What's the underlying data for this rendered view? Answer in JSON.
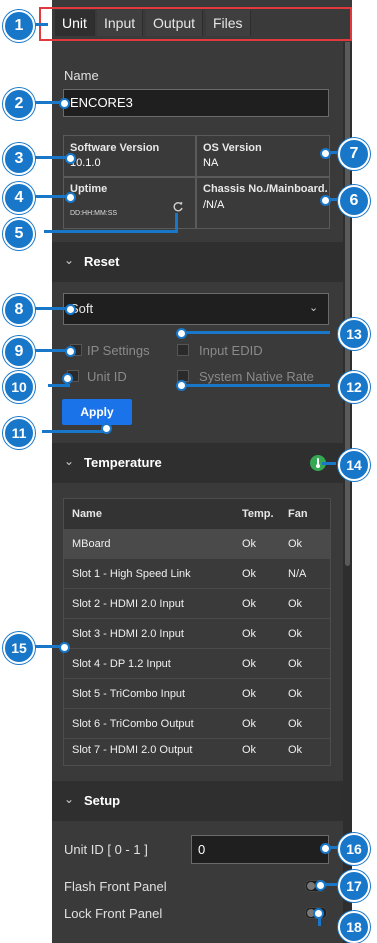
{
  "tabs": [
    {
      "label": "Unit"
    },
    {
      "label": "Input"
    },
    {
      "label": "Output"
    },
    {
      "label": "Files"
    }
  ],
  "name_field": {
    "label": "Name",
    "value": "ENCORE3"
  },
  "info": {
    "software_version": {
      "title": "Software Version",
      "value": "10.1.0"
    },
    "os_version": {
      "title": "OS Version",
      "value": "NA"
    },
    "uptime": {
      "title": "Uptime",
      "value": "DD:HH:MM:SS"
    },
    "chassis": {
      "title": "Chassis No./Mainboard...",
      "value": "/N/A"
    }
  },
  "reset": {
    "title": "Reset",
    "dropdown_value": "Soft",
    "options": [
      {
        "label": "IP Settings"
      },
      {
        "label": "Input EDID"
      },
      {
        "label": "Unit ID"
      },
      {
        "label": "System Native Rate"
      }
    ],
    "apply_label": "Apply"
  },
  "temperature": {
    "title": "Temperature",
    "status_color": "#34a853",
    "headers": {
      "name": "Name",
      "temp": "Temp.",
      "fan": "Fan"
    },
    "rows": [
      {
        "name": "MBoard",
        "temp": "Ok",
        "fan": "Ok"
      },
      {
        "name": "Slot 1 - High Speed Link",
        "temp": "Ok",
        "fan": "N/A"
      },
      {
        "name": "Slot 2 - HDMI 2.0 Input",
        "temp": "Ok",
        "fan": "Ok"
      },
      {
        "name": "Slot 3 - HDMI 2.0 Input",
        "temp": "Ok",
        "fan": "Ok"
      },
      {
        "name": "Slot 4 - DP 1.2 Input",
        "temp": "Ok",
        "fan": "Ok"
      },
      {
        "name": "Slot 5 - TriCombo Input",
        "temp": "Ok",
        "fan": "Ok"
      },
      {
        "name": "Slot 6 - TriCombo Output",
        "temp": "Ok",
        "fan": "Ok"
      },
      {
        "name": "Slot 7 - HDMI 2.0 Output",
        "temp": "Ok",
        "fan": "Ok"
      }
    ]
  },
  "setup": {
    "title": "Setup",
    "unit_id_label": "Unit ID [ 0 - 1 ]",
    "unit_id_value": "0",
    "flash_front_panel_label": "Flash Front Panel",
    "lock_front_panel_label": "Lock Front Panel"
  },
  "callouts": [
    "1",
    "2",
    "3",
    "4",
    "5",
    "6",
    "7",
    "8",
    "9",
    "10",
    "11",
    "12",
    "13",
    "14",
    "15",
    "16",
    "17",
    "18"
  ],
  "colors": {
    "callout": "#1877c9",
    "highlight": "#e03a3e",
    "apply": "#1a73e8"
  }
}
